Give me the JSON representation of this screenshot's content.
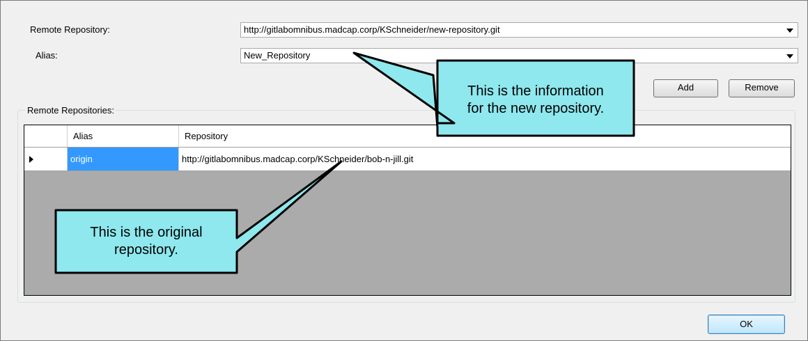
{
  "form": {
    "remote_repository_label": "Remote Repository:",
    "remote_repository_value": "http://gitlabomnibus.madcap.corp/KSchneider/new-repository.git",
    "alias_label": "Alias:",
    "alias_value": "New_Repository",
    "add_label": "Add",
    "remove_label": "Remove"
  },
  "remotes": {
    "group_label": "Remote Repositories:",
    "columns": [
      "Alias",
      "Repository"
    ],
    "rows": [
      {
        "alias": "origin",
        "repository": "http://gitlabomnibus.madcap.corp/KSchneider/bob-n-jill.git"
      }
    ]
  },
  "footer": {
    "ok_label": "OK"
  },
  "callouts": {
    "new_line1": "This is the information",
    "new_line2": "for the new repository.",
    "orig_line1": "This is the original",
    "orig_line2": "repository."
  },
  "colors": {
    "callout_fill": "#8ee8ee",
    "selection": "#3399ff",
    "grid_empty": "#ababab"
  }
}
